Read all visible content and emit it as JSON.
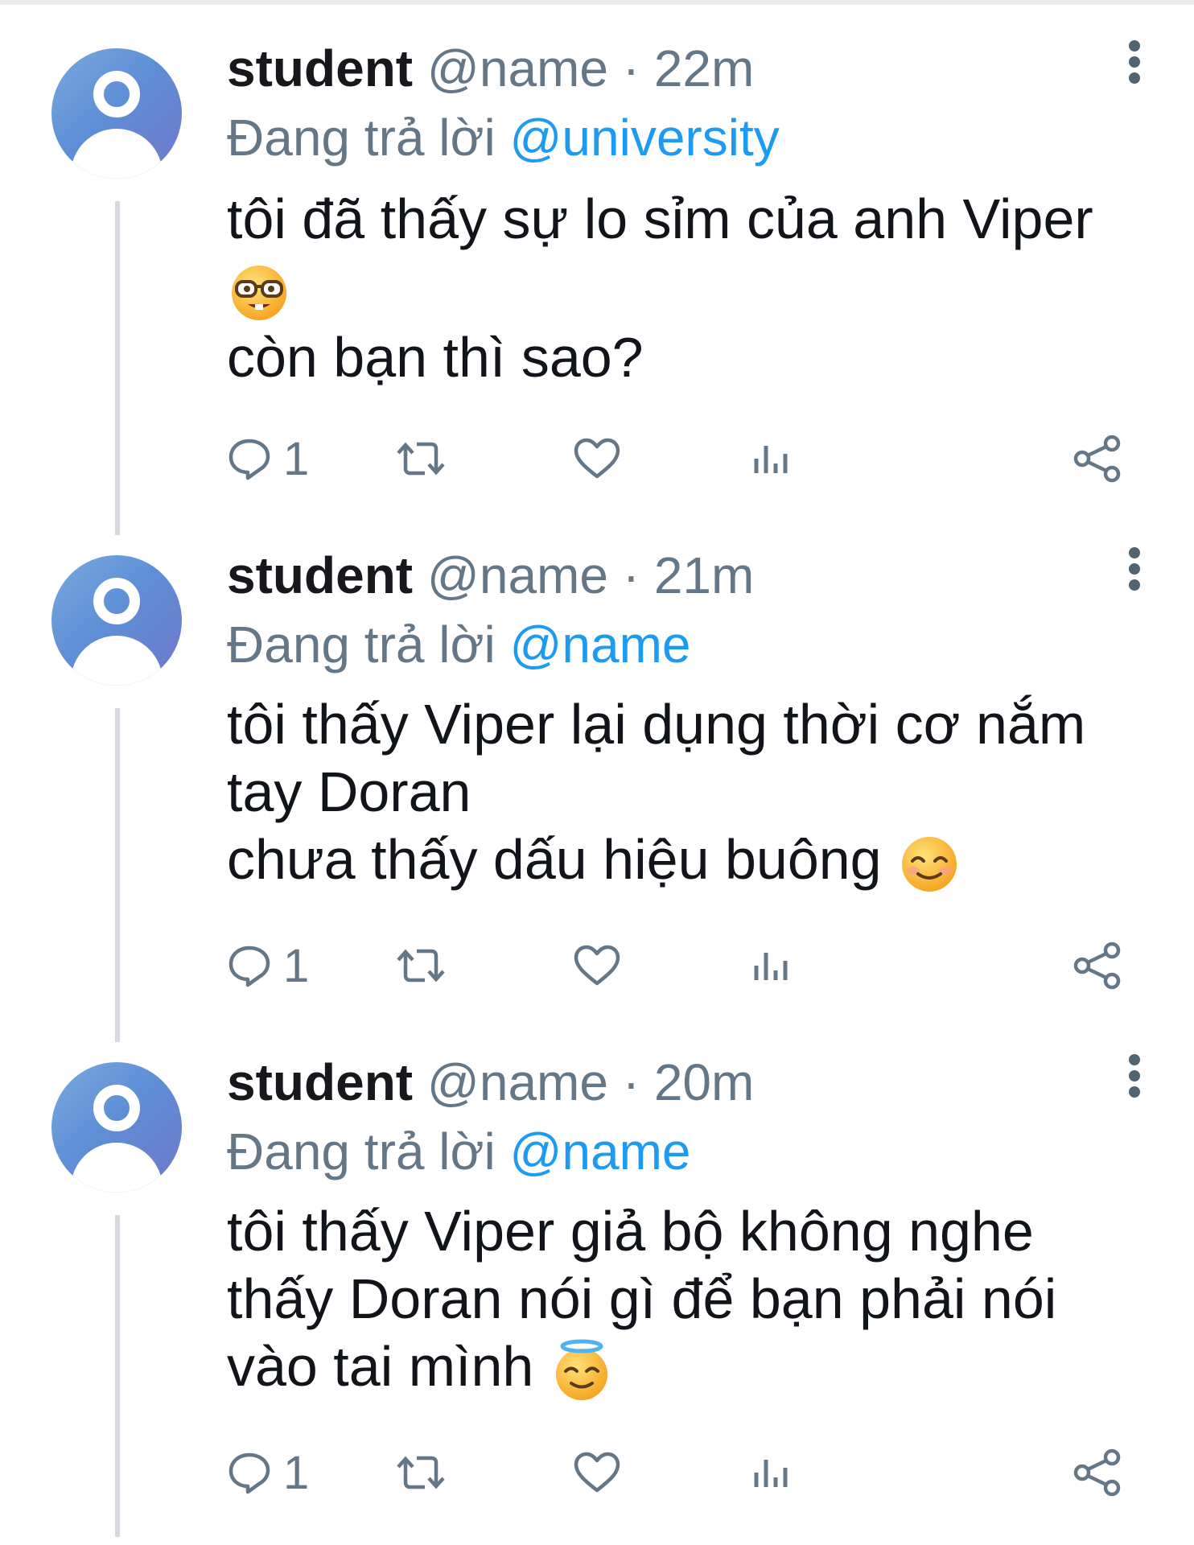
{
  "tweets": [
    {
      "name": "student",
      "handle": "@name",
      "separator": "·",
      "time": "22m",
      "reply_prefix": "Đang trả lời",
      "reply_to": "@university",
      "lines": [
        "tôi đã thấy sự lo sỉm của anh Viper",
        "",
        "còn bạn thì sao?"
      ],
      "emoji": "nerd-face",
      "reply_count": "1"
    },
    {
      "name": "student",
      "handle": "@name",
      "separator": "·",
      "time": "21m",
      "reply_prefix": "Đang trả lời",
      "reply_to": "@name",
      "lines": [
        "tôi thấy Viper lại dụng thời cơ nắm",
        "tay Doran",
        "chưa thấy dấu hiệu buông"
      ],
      "emoji": "smiling-face",
      "reply_count": "1"
    },
    {
      "name": "student",
      "handle": "@name",
      "separator": "·",
      "time": "20m",
      "reply_prefix": "Đang trả lời",
      "reply_to": "@name",
      "lines": [
        "tôi thấy Viper giả bộ không nghe",
        "thấy Doran nói gì để bạn phải nói",
        "vào tai mình"
      ],
      "emoji": "halo-face",
      "reply_count": "1"
    }
  ],
  "icons": {
    "reply": "reply-icon",
    "retweet": "retweet-icon",
    "like": "heart-icon",
    "views": "views-icon",
    "share": "share-icon",
    "more": "more-options-icon"
  },
  "colors": {
    "text": "#111418",
    "secondary": "#657786",
    "link": "#1d9bf0",
    "avatar": "#6f8fd6",
    "thread_line": "#d6d9dd"
  }
}
